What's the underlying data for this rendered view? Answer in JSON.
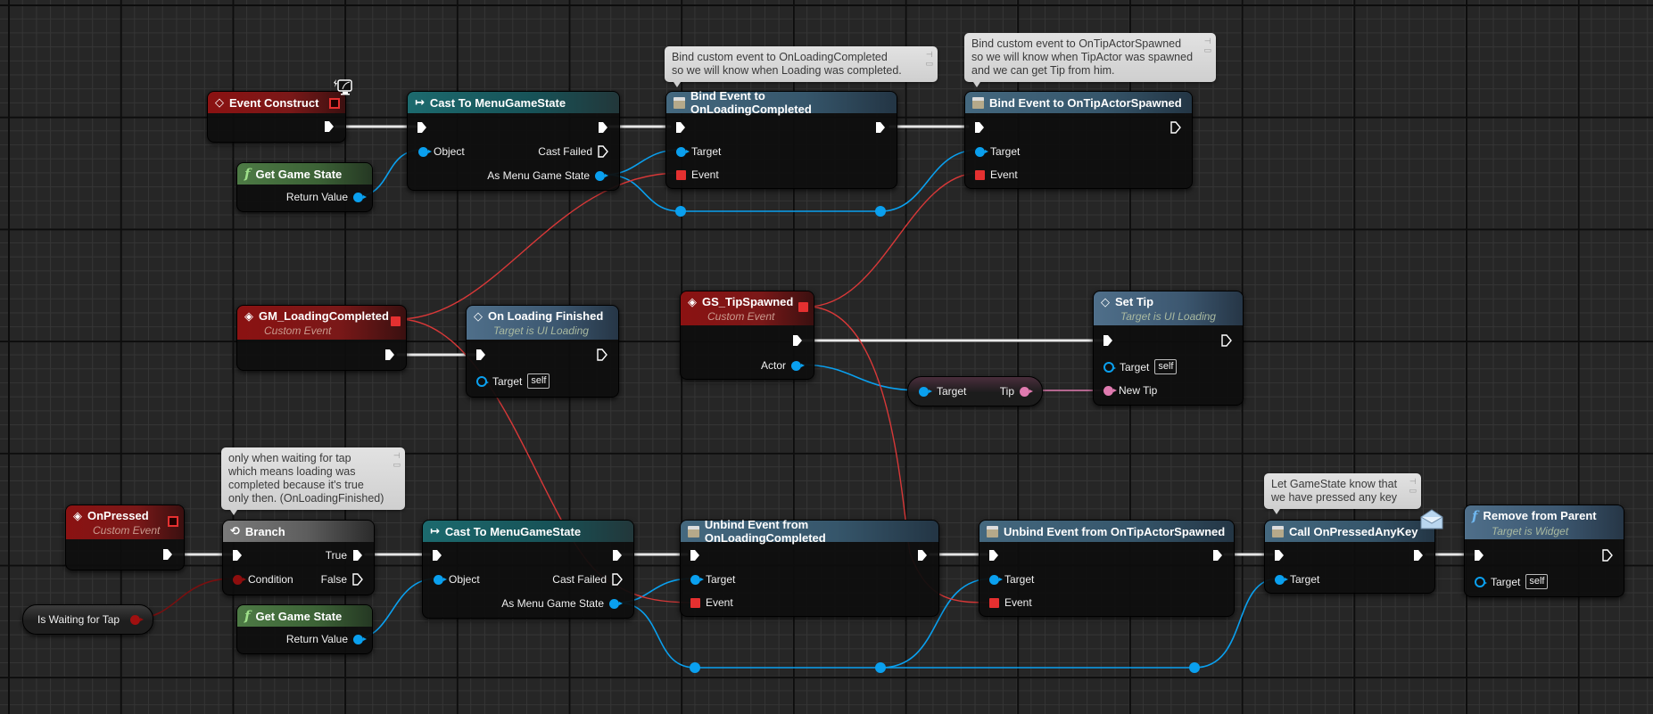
{
  "colors": {
    "exec": "#ffffff",
    "object": "#0aa0ef",
    "delegate": "#e53030",
    "bool": "#8e0e0e",
    "string": "#e07bb0",
    "event_header": "#8b1212",
    "cast_header": "#1c6a6e",
    "function_header": "#4f6f8a",
    "pure_header": "#4d7a45",
    "comment_bg": "#d9d9d9"
  },
  "nodes": {
    "event_construct": {
      "title": "Event Construct",
      "icon": "event-diamond-icon",
      "badge": "widget-monitor-icon"
    },
    "get_game_state_1": {
      "title": "Get Game State",
      "icon": "function-f-icon",
      "return_label": "Return Value"
    },
    "cast_1": {
      "title": "Cast To MenuGameState",
      "icon": "cast-arrow-icon",
      "object_label": "Object",
      "cast_failed_label": "Cast Failed",
      "as_label": "As Menu Game State"
    },
    "bind_loading": {
      "title": "Bind Event to OnLoadingCompleted",
      "icon": "delegate-icon",
      "target_label": "Target",
      "event_label": "Event"
    },
    "bind_tip": {
      "title": "Bind Event to OnTipActorSpawned",
      "icon": "delegate-icon",
      "target_label": "Target",
      "event_label": "Event"
    },
    "gm_loading_completed": {
      "title": "GM_LoadingCompleted",
      "subtitle": "Custom Event",
      "icon": "custom-event-icon"
    },
    "on_loading_finished": {
      "title": "On Loading Finished",
      "subtitle": "Target is UI Loading",
      "icon": "event-diamond-icon",
      "target_label": "Target",
      "self_label": "self"
    },
    "gs_tip_spawned": {
      "title": "GS_TipSpawned",
      "subtitle": "Custom Event",
      "icon": "custom-event-icon",
      "actor_label": "Actor"
    },
    "tip_getter": {
      "target_label": "Target",
      "tip_label": "Tip"
    },
    "set_tip": {
      "title": "Set Tip",
      "subtitle": "Target is UI Loading",
      "icon": "event-diamond-icon",
      "target_label": "Target",
      "self_label": "self",
      "new_tip_label": "New Tip"
    },
    "on_pressed": {
      "title": "OnPressed",
      "subtitle": "Custom Event",
      "icon": "custom-event-icon"
    },
    "branch": {
      "title": "Branch",
      "icon": "branch-icon",
      "true_label": "True",
      "false_label": "False",
      "condition_label": "Condition"
    },
    "is_waiting_for_tap": {
      "label": "Is Waiting for Tap"
    },
    "get_game_state_2": {
      "title": "Get Game State",
      "icon": "function-f-icon",
      "return_label": "Return Value"
    },
    "cast_2": {
      "title": "Cast To MenuGameState",
      "icon": "cast-arrow-icon",
      "object_label": "Object",
      "cast_failed_label": "Cast Failed",
      "as_label": "As Menu Game State"
    },
    "unbind_loading": {
      "title": "Unbind Event from OnLoadingCompleted",
      "icon": "delegate-icon",
      "target_label": "Target",
      "event_label": "Event"
    },
    "unbind_tip": {
      "title": "Unbind Event from OnTipActorSpawned",
      "icon": "delegate-icon",
      "target_label": "Target",
      "event_label": "Event"
    },
    "call_pressed_any_key": {
      "title": "Call OnPressedAnyKey",
      "icon": "delegate-icon",
      "badge": "message-envelope-icon",
      "target_label": "Target"
    },
    "remove_from_parent": {
      "title": "Remove from Parent",
      "subtitle": "Target is Widget",
      "icon": "function-f-icon",
      "target_label": "Target",
      "self_label": "self"
    }
  },
  "comments": {
    "bind_loading": [
      "Bind custom event to OnLoadingCompleted",
      "so we will know when Loading was completed."
    ],
    "bind_tip": [
      "Bind custom event to OnTipActorSpawned",
      "so we will know when TipActor was spawned",
      "and we can get Tip from him."
    ],
    "branch": [
      "only when waiting for tap",
      "which means loading was",
      "completed because it's true",
      "only then. (OnLoadingFinished)"
    ],
    "call_pressed": [
      "Let GameState know that",
      "we have pressed any key"
    ]
  }
}
